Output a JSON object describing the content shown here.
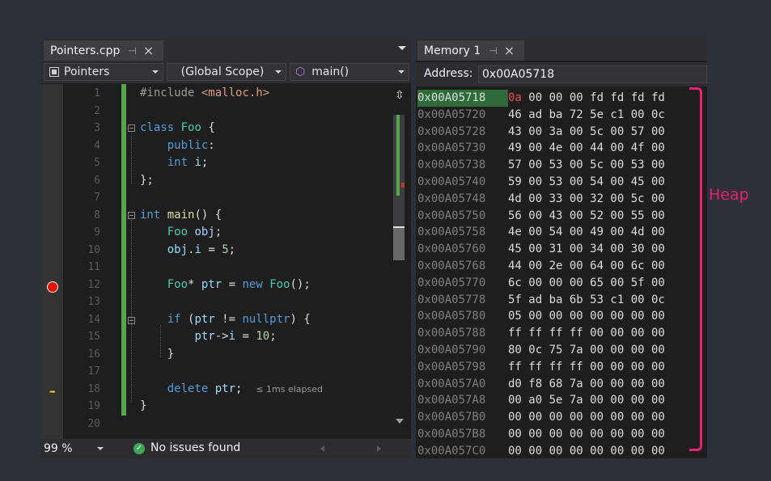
{
  "editor": {
    "tab": {
      "title": "Pointers.cpp",
      "pin": "⊣",
      "close": "×"
    },
    "nav": {
      "project": "Pointers",
      "scope": "(Global Scope)",
      "member": "main()"
    },
    "lines": [
      {
        "n": "1",
        "html": "<span class=\"pp\">#include</span> <span class=\"inc\">&lt;malloc.h&gt;</span>"
      },
      {
        "n": "2",
        "html": ""
      },
      {
        "n": "3",
        "html": "<span class=\"kw\">class</span> <span class=\"ty\">Foo</span> {"
      },
      {
        "n": "4",
        "html": "    <span class=\"kw\">public</span>:"
      },
      {
        "n": "5",
        "html": "    <span class=\"kw\">int</span> <span class=\"var\">i</span>;"
      },
      {
        "n": "6",
        "html": "};"
      },
      {
        "n": "7",
        "html": ""
      },
      {
        "n": "8",
        "html": "<span class=\"kw\">int</span> <span class=\"fn\">main</span>() {"
      },
      {
        "n": "9",
        "html": "    <span class=\"ty\">Foo</span> <span class=\"var\">obj</span>;"
      },
      {
        "n": "10",
        "html": "    <span class=\"var\">obj</span>.<span class=\"var\">i</span> = <span class=\"num\">5</span>;"
      },
      {
        "n": "11",
        "html": ""
      },
      {
        "n": "12",
        "html": "    <span class=\"ty\">Foo</span>* <span class=\"var\">ptr</span> = <span class=\"kw\">new</span> <span class=\"ty\">Foo</span>();"
      },
      {
        "n": "13",
        "html": ""
      },
      {
        "n": "14",
        "html": "    <span class=\"kw\">if</span> (<span class=\"var\">ptr</span> != <span class=\"kw\">nullptr</span>) {"
      },
      {
        "n": "15",
        "html": "        <span class=\"var\">ptr</span>-&gt;<span class=\"var\">i</span> = <span class=\"num\">10</span>;"
      },
      {
        "n": "16",
        "html": "    }"
      },
      {
        "n": "17",
        "html": ""
      },
      {
        "n": "18",
        "html": "    <span class=\"kw\">delete</span> <span class=\"var\">ptr</span>;  <span class=\"hint\">≤ 1ms elapsed</span>"
      },
      {
        "n": "19",
        "html": "}"
      },
      {
        "n": "20",
        "html": ""
      }
    ],
    "status": {
      "zoom": "99 %",
      "issues": "No issues found"
    }
  },
  "memory": {
    "tab": {
      "title": "Memory 1",
      "pin": "⊣",
      "close": "×"
    },
    "address_label": "Address:",
    "address_value": "0x00A05718",
    "rows": [
      {
        "addr": "0x00A05718",
        "first": "0a",
        "rest": " 00 00 00 fd fd fd fd"
      },
      {
        "addr": "0x00A05720",
        "first": "",
        "rest": "46 ad ba 72 5e c1 00 0c"
      },
      {
        "addr": "0x00A05728",
        "first": "",
        "rest": "43 00 3a 00 5c 00 57 00"
      },
      {
        "addr": "0x00A05730",
        "first": "",
        "rest": "49 00 4e 00 44 00 4f 00"
      },
      {
        "addr": "0x00A05738",
        "first": "",
        "rest": "57 00 53 00 5c 00 53 00"
      },
      {
        "addr": "0x00A05740",
        "first": "",
        "rest": "59 00 53 00 54 00 45 00"
      },
      {
        "addr": "0x00A05748",
        "first": "",
        "rest": "4d 00 33 00 32 00 5c 00"
      },
      {
        "addr": "0x00A05750",
        "first": "",
        "rest": "56 00 43 00 52 00 55 00"
      },
      {
        "addr": "0x00A05758",
        "first": "",
        "rest": "4e 00 54 00 49 00 4d 00"
      },
      {
        "addr": "0x00A05760",
        "first": "",
        "rest": "45 00 31 00 34 00 30 00"
      },
      {
        "addr": "0x00A05768",
        "first": "",
        "rest": "44 00 2e 00 64 00 6c 00"
      },
      {
        "addr": "0x00A05770",
        "first": "",
        "rest": "6c 00 00 00 65 00 5f 00"
      },
      {
        "addr": "0x00A05778",
        "first": "",
        "rest": "5f ad ba 6b 53 c1 00 0c"
      },
      {
        "addr": "0x00A05780",
        "first": "",
        "rest": "05 00 00 00 00 00 00 00"
      },
      {
        "addr": "0x00A05788",
        "first": "",
        "rest": "ff ff ff ff 00 00 00 00"
      },
      {
        "addr": "0x00A05790",
        "first": "",
        "rest": "80 0c 75 7a 00 00 00 00"
      },
      {
        "addr": "0x00A05798",
        "first": "",
        "rest": "ff ff ff ff 00 00 00 00"
      },
      {
        "addr": "0x00A057A0",
        "first": "",
        "rest": "d0 f8 68 7a 00 00 00 00"
      },
      {
        "addr": "0x00A057A8",
        "first": "",
        "rest": "00 a0 5e 7a 00 00 00 00"
      },
      {
        "addr": "0x00A057B0",
        "first": "",
        "rest": "00 00 00 00 00 00 00 00"
      },
      {
        "addr": "0x00A057B8",
        "first": "",
        "rest": "00 00 00 00 00 00 00 00"
      },
      {
        "addr": "0x00A057C0",
        "first": "",
        "rest": "00 00 00 00 00 00 00 00"
      }
    ]
  },
  "annotation": {
    "label": "Heap",
    "color": "#e6246f"
  },
  "icons": {
    "breakpoint": "breakpoint-icon",
    "instruction_pointer": "arrow-right-icon",
    "ok": "check-circle-icon"
  }
}
